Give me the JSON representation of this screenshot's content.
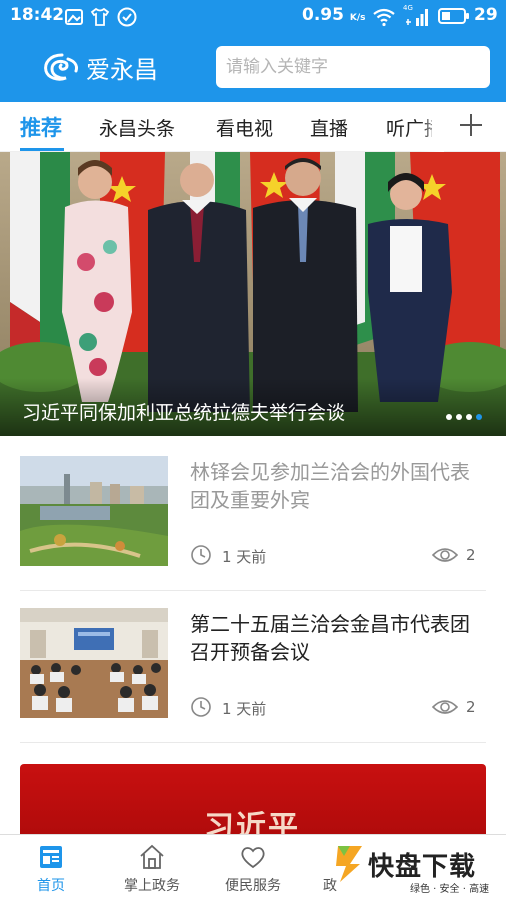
{
  "status_bar": {
    "time": "18:42",
    "network_speed": "0.95",
    "network_unit": "K/s",
    "network_type": "4G",
    "battery": "29"
  },
  "header": {
    "app_name": "爱永昌",
    "search_placeholder": "请输入关键字",
    "accent_color": "#1e95ea"
  },
  "tabs": [
    {
      "label": "推荐",
      "active": true
    },
    {
      "label": "永昌头条"
    },
    {
      "label": "看电视"
    },
    {
      "label": "直播"
    },
    {
      "label": "听广播"
    }
  ],
  "banner": {
    "caption": "习近平同保加利亚总统拉德夫举行会谈",
    "slide_count": 4,
    "active_slide": 4
  },
  "news": [
    {
      "title": "林铎会见参加兰洽会的外国代表团及重要外宾",
      "time": "1 天前",
      "views": "2",
      "read": true
    },
    {
      "title": "第二十五届兰洽会金昌市代表团召开预备会议",
      "time": "1 天前",
      "views": "2",
      "read": false
    }
  ],
  "promo": {
    "text": "习近平"
  },
  "bottom_nav": [
    {
      "label": "首页",
      "icon": "news-icon",
      "active": true
    },
    {
      "label": "掌上政务",
      "icon": "home-icon"
    },
    {
      "label": "便民服务",
      "icon": "heart-icon"
    },
    {
      "label": "政",
      "icon": "gov-icon"
    }
  ],
  "watermark": {
    "main": "快盘下载",
    "sub": "绿色 · 安全 · 高速"
  }
}
